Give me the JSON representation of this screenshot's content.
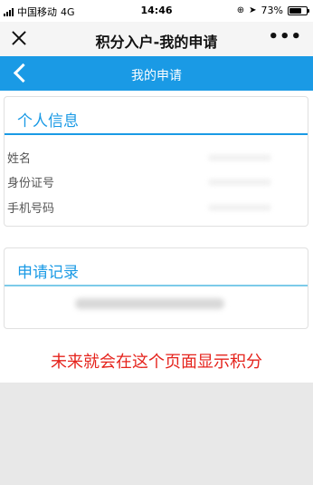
{
  "status_bar": {
    "carrier": "中国移动",
    "network": "4G",
    "time": "14:46",
    "battery_percent": "73%",
    "battery_level": 0.73
  },
  "wechat_bar": {
    "title": "积分入户-我的申请",
    "more_label": "•••"
  },
  "header": {
    "title": "我的申请"
  },
  "personal_info": {
    "section_title": "个人信息",
    "fields": [
      "姓名",
      "身份证号",
      "手机号码"
    ]
  },
  "records": {
    "section_title": "申请记录"
  },
  "note": "未来就会在这个页面显示积分",
  "colors": {
    "accent": "#1a9ae5",
    "note": "#e5231c"
  }
}
